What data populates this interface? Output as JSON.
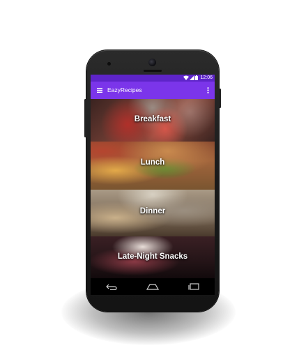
{
  "status_bar": {
    "time": "12:06",
    "icons": [
      "wifi-icon",
      "signal-icon",
      "battery-icon"
    ]
  },
  "app_bar": {
    "title": "EazyRecipes",
    "menu_icon": "hamburger-menu-icon",
    "overflow_icon": "more-vert-icon"
  },
  "categories": [
    {
      "label": "Breakfast"
    },
    {
      "label": "Lunch"
    },
    {
      "label": "Dinner"
    },
    {
      "label": "Late-Night Snacks"
    }
  ],
  "nav_bar": {
    "icons": [
      "back-icon",
      "home-icon",
      "recent-apps-icon"
    ]
  },
  "colors": {
    "status_bar": "#5e24c9",
    "app_bar": "#7b35ea",
    "text": "#ffffff"
  }
}
